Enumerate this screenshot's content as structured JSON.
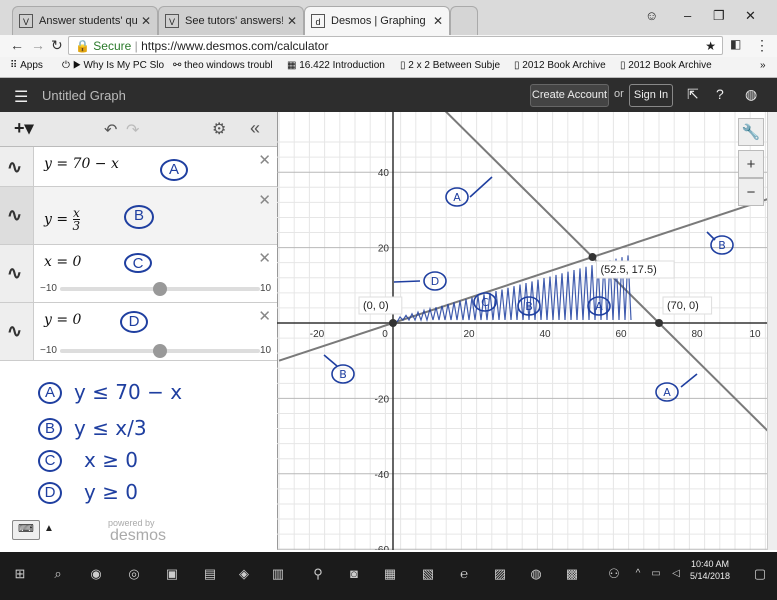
{
  "browser": {
    "tabs": [
      {
        "label": "Answer students' questic",
        "icon": "V"
      },
      {
        "label": "See tutors' answers!",
        "icon": "V"
      },
      {
        "label": "Desmos | Graphing Calcu",
        "icon": "d"
      }
    ],
    "address": {
      "secure_label": "Secure",
      "url": "https://www.desmos.com/calculator"
    },
    "bookmarks": [
      "Apps",
      "Why Is My PC Slo",
      "theo windows troubl",
      "16.422 Introduction",
      "2 x 2 Between Subje",
      "2012 Book Archive",
      "2012 Book Archive"
    ],
    "bookmarks_more": "»"
  },
  "desmos": {
    "title": "Untitled Graph",
    "create_account": "Create Account",
    "or": "or",
    "sign_in": "Sign In",
    "expressions": [
      {
        "latex": "y = 70 − x",
        "note": "A"
      },
      {
        "latex": "y = x/3",
        "num": "x",
        "den": "3",
        "note": "B"
      },
      {
        "latex": "x = 0",
        "note": "C",
        "slider": {
          "min": "−10",
          "max": "10"
        }
      },
      {
        "latex": "y = 0",
        "note": "D",
        "slider": {
          "min": "−10",
          "max": "10"
        }
      }
    ],
    "handwritten_notes": [
      {
        "label": "A",
        "text": "y ≤ 70 − x"
      },
      {
        "label": "B",
        "text": "y ≤ x/3"
      },
      {
        "label": "C",
        "text": "x ≥ 0"
      },
      {
        "label": "D",
        "text": "y ≥ 0"
      }
    ],
    "powered_by": "powered by",
    "logo": "desmos"
  },
  "chart_data": {
    "type": "line",
    "xlim": [
      -30,
      100
    ],
    "ylim": [
      -60,
      50
    ],
    "xticks": [
      "-20",
      "0",
      "20",
      "40",
      "60",
      "80",
      "10"
    ],
    "yticks": [
      "40",
      "20",
      "-20",
      "-40",
      "-60"
    ],
    "grid": true,
    "series": [
      {
        "equation": "y = 70 − x",
        "slope": -1,
        "intercept": 70
      },
      {
        "equation": "y = x/3",
        "slope": 0.3333,
        "intercept": 0
      }
    ],
    "points": [
      {
        "x": 0,
        "y": 0,
        "label": "(0, 0)"
      },
      {
        "x": 52.5,
        "y": 17.5,
        "label": "(52.5, 17.5)"
      },
      {
        "x": 70,
        "y": 0,
        "label": "(70, 0)"
      }
    ],
    "annotations": [
      "A",
      "B",
      "D",
      "C",
      "B",
      "A",
      "B",
      "A"
    ]
  },
  "taskbar": {
    "time": "10:40 AM",
    "date": "5/14/2018"
  },
  "colors": {
    "header": "#2d2d2d",
    "ink": "#1f3fa0",
    "curve": "#888888"
  }
}
